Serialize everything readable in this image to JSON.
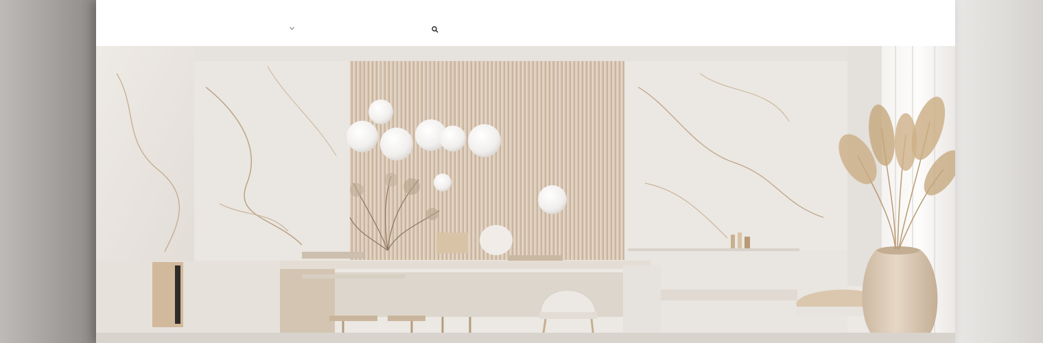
{
  "topbar": {
    "items": [
      "",
      "",
      "",
      "",
      "",
      "",
      "",
      "",
      ""
    ],
    "right_items": [
      "",
      "",
      ""
    ]
  },
  "nav": {
    "brand": "",
    "items": [
      "",
      "",
      "",
      "",
      "",
      "",
      "",
      ""
    ],
    "search_label": ""
  },
  "colors": {
    "page_bg": "#ffffff",
    "marble": "#e7e3de",
    "marble_vein": "#b9a386",
    "slat_wood": "#d9c7b4",
    "island": "#d3c7b9",
    "pampas": "#c6a77a",
    "vase": "#d8c6b0"
  },
  "icons": [
    "search-icon",
    "chevron-down-icon"
  ]
}
